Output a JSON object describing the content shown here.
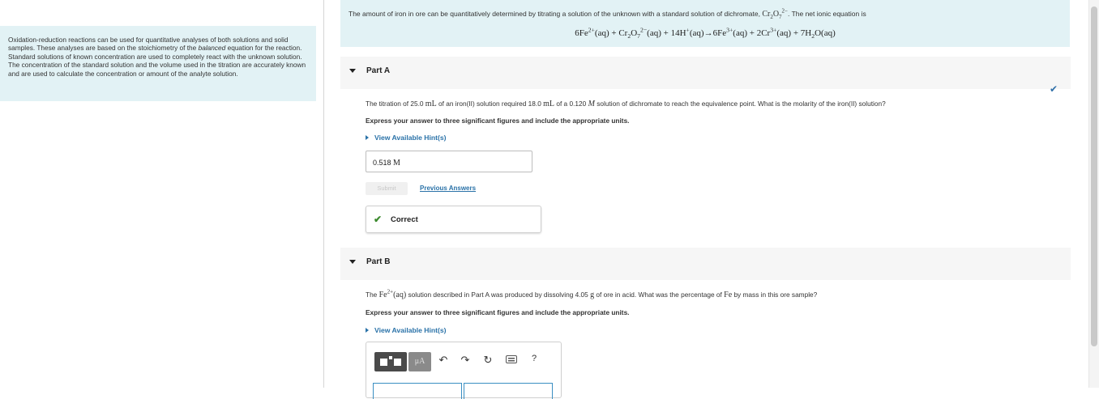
{
  "intro": {
    "text_before": "Oxidation-reduction reactions can be used for quantitative analyses of both solutions and solid samples. These analyses are based on the stoichiometry of the ",
    "text_italic": "balanced",
    "text_after": " equation for the reaction. Standard solutions of known concentration are used to completely react with the unknown solution. The concentration of the standard solution and the volume used in the titration are accurately known and are used to calculate the concentration or amount of the analyte solution."
  },
  "problem": {
    "text_before": "The amount of iron in ore can be quantitatively determined by titrating a solution of the unknown with a standard solution of dichromate, ",
    "text_after": ". The net ionic equation is"
  },
  "part_a": {
    "title": "Part A",
    "question_1": "The titration of 25.0 ",
    "unit_ml_1": "mL",
    "question_2": " of an iron(II) solution required 18.0 ",
    "unit_ml_2": "mL",
    "question_3": " of a 0.120 ",
    "unit_m": "M",
    "question_4": " solution of dichromate to reach the equivalence point. What is the molarity of the iron(II) solution?",
    "instruction": "Express your answer to three significant figures and include the appropriate units.",
    "hint_label": "View Available Hint(s)",
    "answer_number": "0.518",
    "answer_unit": "M",
    "submit_label": "Submit",
    "previous_answers_label": "Previous Answers",
    "feedback": "Correct"
  },
  "part_b": {
    "title": "Part B",
    "question_1": "The ",
    "question_2": " solution described in Part A was produced by dissolving 4.05 ",
    "unit_g": "g",
    "question_3": " of ore in acid. What was the percentage of ",
    "element": "Fe",
    "question_4": " by mass in this ore sample?",
    "instruction": "Express your answer to three significant figures and include the appropriate units.",
    "hint_label": "View Available Hint(s)",
    "toolbar": {
      "units_label": "μA",
      "help_label": "?",
      "icons": [
        "templates-icon",
        "units-icon",
        "undo-icon",
        "redo-icon",
        "reset-icon",
        "keyboard-icon",
        "help-icon"
      ]
    }
  },
  "colors": {
    "panel_bg": "#e2f2f5",
    "link": "#2a72a8",
    "correct": "#3c8a2e",
    "part_header_bg": "#f6f6f6"
  }
}
